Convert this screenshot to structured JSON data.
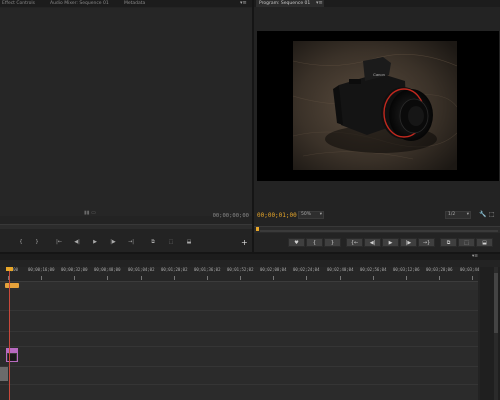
{
  "source_panel": {
    "tabs": [
      "Effect Controls",
      "Audio Mixer: Sequence 01",
      "Metadata"
    ],
    "timecode": "00;00;00;00",
    "transport_labels": [
      "{",
      "}",
      "|←",
      "◀|",
      "▶",
      "|▶",
      "→|",
      "⧉",
      "⬚",
      "⬓"
    ]
  },
  "program_panel": {
    "tab": "Program: Sequence 01",
    "timecode": "00;00;01;00",
    "zoom": "50%",
    "resolution": "1/2",
    "transport_labels": [
      "♥",
      "{",
      "}",
      "{←",
      "◀|",
      "▶",
      "|▶",
      "→}",
      "⧉",
      "⬚",
      "⬓"
    ]
  },
  "timeline": {
    "ruler_labels": [
      "00;00",
      "00;00;16;00",
      "00;00;32;00",
      "00;00;48;00",
      "00;01;04;02",
      "00;01;20;02",
      "00;01;36;02",
      "00;01;52;02",
      "00;02;08;04",
      "00;02;24;04",
      "00;02;40;04",
      "00;02;56;04",
      "00;03;12;06",
      "00;03;28;06",
      "00;03;44"
    ],
    "video_clip_label": "",
    "audio_clip_label": ""
  },
  "colors": {
    "accent": "#e8a72a",
    "playhead": "#c9483a",
    "clip_video": "#e6a23a",
    "clip_audio": "#b86ac0"
  },
  "icons": {
    "panel_menu": "panel-menu-icon",
    "wrench": "wrench-icon",
    "add": "add-icon"
  }
}
